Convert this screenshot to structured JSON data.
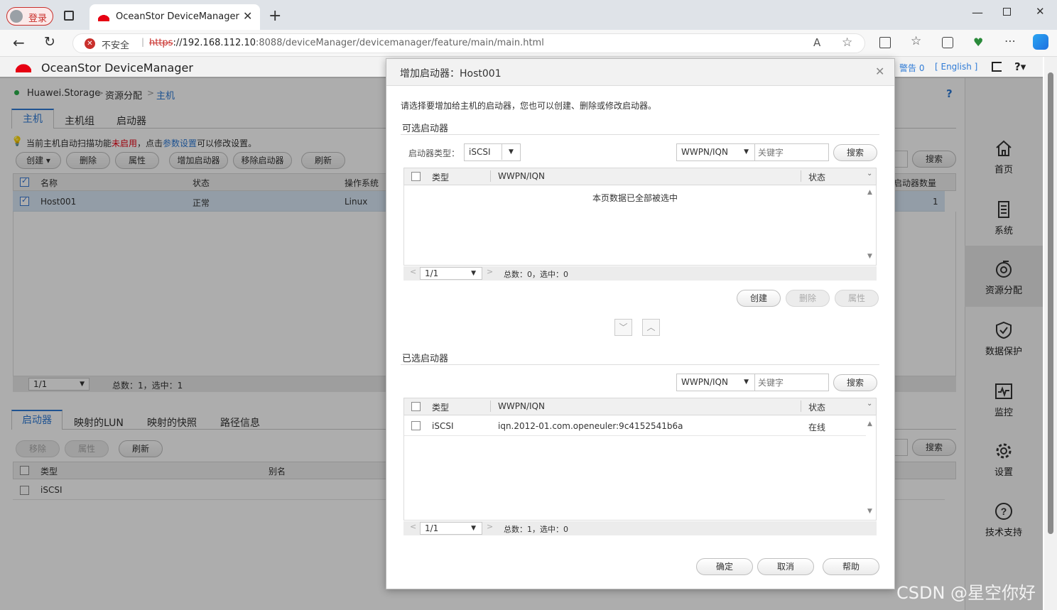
{
  "browser": {
    "login_label": "登录",
    "tab_title": "OceanStor DeviceManager",
    "insecure_label": "不安全",
    "url_scheme": "https",
    "url_host": "://192.168.112.10",
    "url_rest": ":8088/deviceManager/devicemanager/feature/main/main.html"
  },
  "app": {
    "title": "OceanStor DeviceManager",
    "alarm_label": "警告 0",
    "language_label": "[ English ]",
    "breadcrumb": [
      "Huawei.Storage",
      "资源分配",
      "主机"
    ],
    "help_q": "?"
  },
  "main": {
    "tabs": [
      "主机",
      "主机组",
      "启动器"
    ],
    "notice_prefix": "当前主机自动扫描功能",
    "notice_state": "未启用",
    "notice_mid": "，点击",
    "notice_link": "参数设置",
    "notice_suffix": "可以修改设置。",
    "toolbar": [
      "创建",
      "删除",
      "属性",
      "增加启动器",
      "移除启动器",
      "刷新"
    ],
    "search_label": "搜索",
    "columns": [
      "名称",
      "状态",
      "操作系统",
      "启动器数量"
    ],
    "rows": [
      {
        "name": "Host001",
        "status": "正常",
        "os": "Linux",
        "count": "1"
      }
    ],
    "pager": "1/1",
    "summary": "总数：1，选中：1",
    "bottom_tabs": [
      "启动器",
      "映射的LUN",
      "映射的快照",
      "路径信息"
    ],
    "bottom_toolbar": [
      "移除",
      "属性",
      "刷新"
    ],
    "bottom_search": "搜索",
    "bottom_columns": [
      "类型",
      "别名"
    ],
    "bottom_rows": [
      {
        "type": "iSCSI"
      }
    ]
  },
  "sidebar": {
    "items": [
      {
        "label": "首页",
        "icon": "home-icon"
      },
      {
        "label": "系统",
        "icon": "system-icon"
      },
      {
        "label": "资源分配",
        "icon": "resource-icon"
      },
      {
        "label": "数据保护",
        "icon": "shield-icon"
      },
      {
        "label": "监控",
        "icon": "monitor-icon"
      },
      {
        "label": "设置",
        "icon": "gear-icon"
      },
      {
        "label": "技术支持",
        "icon": "help-icon"
      }
    ]
  },
  "dialog": {
    "title": "增加启动器：Host001",
    "intro": "请选择要增加给主机的启动器，您也可以创建、删除或修改启动器。",
    "available_title": "可选启动器",
    "type_label": "启动器类型：",
    "type_value": "iSCSI",
    "filter_value": "WWPN/IQN",
    "keyword_placeholder": "关键字",
    "search_label": "搜索",
    "columns": [
      "类型",
      "WWPN/IQN",
      "状态"
    ],
    "available_empty": "本页数据已全部被选中",
    "available_pager": "1/1",
    "available_summary": "总数：0，选中：0",
    "available_actions": [
      "创建",
      "删除",
      "属性"
    ],
    "selected_title": "已选启动器",
    "selected_rows": [
      {
        "type": "iSCSI",
        "wwpn": "iqn.2012-01.com.openeuler:9c4152541b6a",
        "status": "在线"
      }
    ],
    "selected_pager": "1/1",
    "selected_summary": "总数：1，选中：0",
    "footer": [
      "确定",
      "取消",
      "帮助"
    ]
  },
  "watermark": "CSDN @星空你好"
}
